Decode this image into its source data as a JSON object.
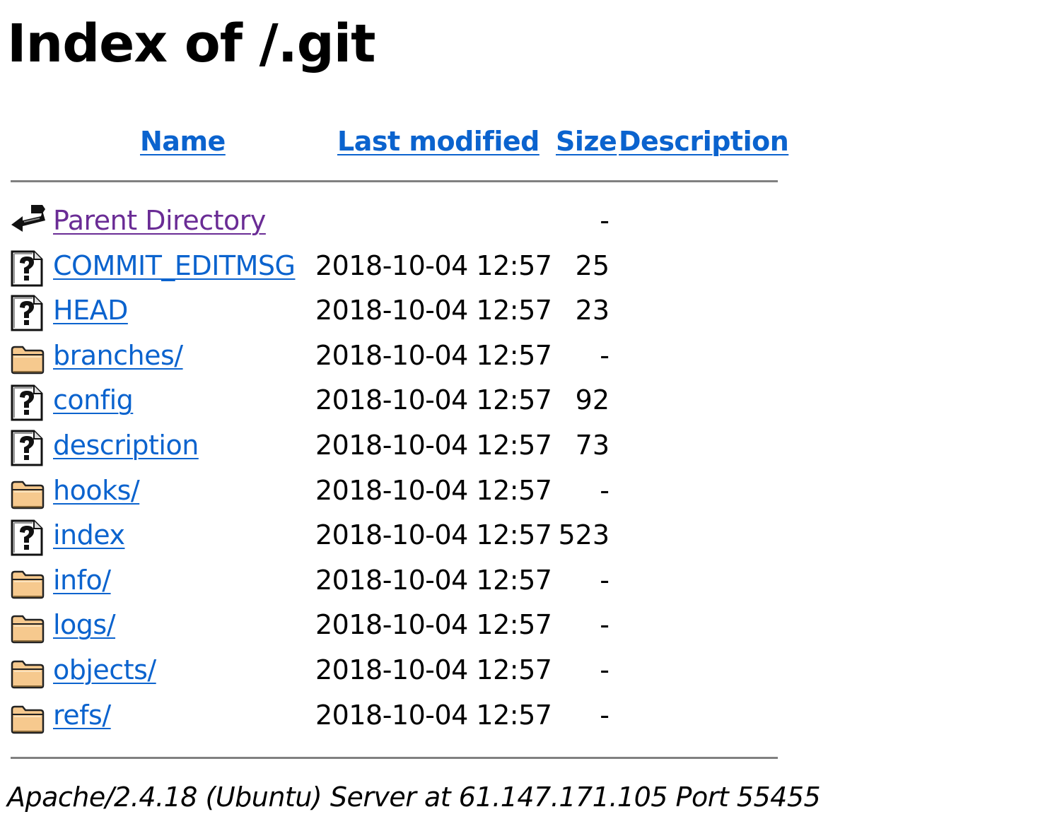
{
  "page": {
    "title": "Index of /.git",
    "footer": "Apache/2.4.18 (Ubuntu) Server at 61.147.171.105 Port 55455"
  },
  "columns": {
    "name": "Name",
    "last_modified": "Last modified",
    "size": "Size",
    "description": "Description"
  },
  "entries": [
    {
      "icon": "parent-directory-icon",
      "name": "Parent Directory",
      "date": "",
      "size": "-"
    },
    {
      "icon": "unknown-file-icon",
      "name": "COMMIT_EDITMSG",
      "date": "2018-10-04 12:57",
      "size": "25"
    },
    {
      "icon": "unknown-file-icon",
      "name": "HEAD",
      "date": "2018-10-04 12:57",
      "size": "23"
    },
    {
      "icon": "folder-icon",
      "name": "branches/",
      "date": "2018-10-04 12:57",
      "size": "-"
    },
    {
      "icon": "unknown-file-icon",
      "name": "config",
      "date": "2018-10-04 12:57",
      "size": "92"
    },
    {
      "icon": "unknown-file-icon",
      "name": "description",
      "date": "2018-10-04 12:57",
      "size": "73"
    },
    {
      "icon": "folder-icon",
      "name": "hooks/",
      "date": "2018-10-04 12:57",
      "size": "-"
    },
    {
      "icon": "unknown-file-icon",
      "name": "index",
      "date": "2018-10-04 12:57",
      "size": "523"
    },
    {
      "icon": "folder-icon",
      "name": "info/",
      "date": "2018-10-04 12:57",
      "size": "-"
    },
    {
      "icon": "folder-icon",
      "name": "logs/",
      "date": "2018-10-04 12:57",
      "size": "-"
    },
    {
      "icon": "folder-icon",
      "name": "objects/",
      "date": "2018-10-04 12:57",
      "size": "-"
    },
    {
      "icon": "folder-icon",
      "name": "refs/",
      "date": "2018-10-04 12:57",
      "size": "-"
    }
  ],
  "colors": {
    "link": "#0b63ce",
    "visited_link": "#6a2c95",
    "rule": "#808080"
  }
}
